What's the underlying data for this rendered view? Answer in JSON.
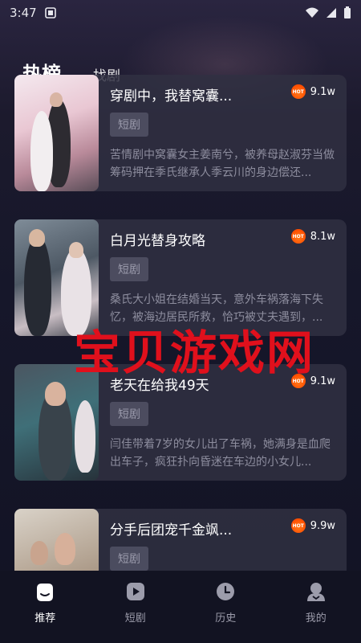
{
  "status_bar": {
    "time": "3:47"
  },
  "header": {
    "tabs": [
      {
        "label": "热榜",
        "active": true
      },
      {
        "label": "找剧",
        "active": false
      }
    ]
  },
  "cards": [
    {
      "title": "穿剧中，我替窝囊...",
      "tag": "短剧",
      "heat": "9.1w",
      "hot_badge": "HOT",
      "description": "苦情剧中窝囊女主姜南兮，被养母赵淑芬当做筹码押在季氏继承人季云川的身边偿还..."
    },
    {
      "title": "白月光替身攻略",
      "tag": "短剧",
      "heat": "8.1w",
      "hot_badge": "HOT",
      "description": "桑氏大小姐在结婚当天，意外车祸落海下失忆，被海边居民所救，恰巧被丈夫遇到，..."
    },
    {
      "title": "老天在给我49天",
      "tag": "短剧",
      "heat": "9.1w",
      "hot_badge": "HOT",
      "description": "闫佳带着7岁的女儿出了车祸，她满身是血爬出车子，疯狂扑向昏迷在车边的小女儿..."
    },
    {
      "title": "分手后团宠千金飒...",
      "tag": "短剧",
      "heat": "9.9w",
      "hot_badge": "HOT",
      "description": ""
    }
  ],
  "watermark": "宝贝游戏网",
  "bottom_nav": [
    {
      "label": "推荐",
      "icon": "home-icon",
      "active": true
    },
    {
      "label": "短剧",
      "icon": "play-icon",
      "active": false
    },
    {
      "label": "历史",
      "icon": "clock-icon",
      "active": false
    },
    {
      "label": "我的",
      "icon": "profile-icon",
      "active": false
    }
  ],
  "colors": {
    "accent_hot": "#ff5a00",
    "watermark": "#e0101c",
    "background": "#16172a"
  }
}
